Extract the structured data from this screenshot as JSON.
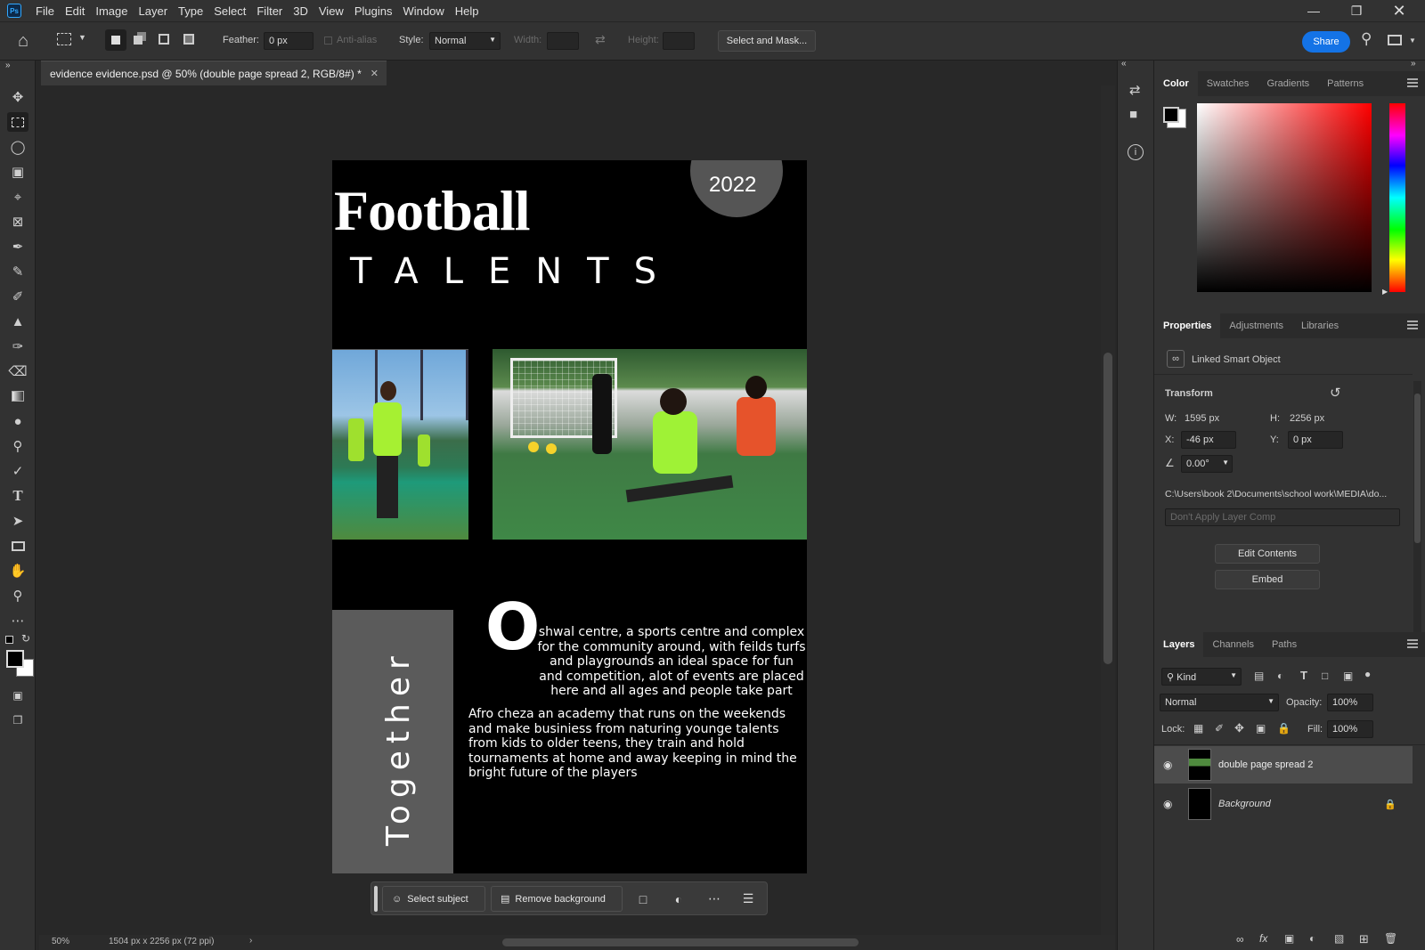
{
  "app": {
    "logo": "Ps",
    "menu": [
      "File",
      "Edit",
      "Image",
      "Layer",
      "Type",
      "Select",
      "Filter",
      "3D",
      "View",
      "Plugins",
      "Window",
      "Help"
    ]
  },
  "options": {
    "feather_label": "Feather:",
    "feather_value": "0 px",
    "antialias_label": "Anti-alias",
    "style_label": "Style:",
    "style_value": "Normal",
    "width_label": "Width:",
    "height_label": "Height:",
    "select_mask": "Select and Mask...",
    "share": "Share"
  },
  "document": {
    "tab_title": "evidence evidence.psd @ 50% (double page spread 2, RGB/8#) *",
    "zoom": "50%",
    "info": "1504 px x 2256 px (72 ppi)"
  },
  "artwork": {
    "year": "2022",
    "title": "Football",
    "subtitle": "TALENTS",
    "vertical": "Together",
    "dropcap": "O",
    "para1": "shwal centre, a sports centre and complex for the community around, with feilds turfs and playgrounds an ideal space for fun and competition, alot of events are placed here and all ages and people take part",
    "para2": "Afro cheza an academy that runs on the weekends and make businiess from naturing younge talents from kids to older teens, they train and hold tournaments at home and away keeping in mind the bright future of the players"
  },
  "color_panel": {
    "tabs": [
      "Color",
      "Swatches",
      "Gradients",
      "Patterns"
    ],
    "hue_color": "#ff0000"
  },
  "properties": {
    "tabs": [
      "Properties",
      "Adjustments",
      "Libraries"
    ],
    "kind": "Linked Smart Object",
    "transform": "Transform",
    "w_label": "W:",
    "w": "1595 px",
    "h_label": "H:",
    "h": "2256 px",
    "x_label": "X:",
    "x": "-46 px",
    "y_label": "Y:",
    "y": "0 px",
    "angle": "0.00°",
    "path": "C:\\Users\\book 2\\Documents\\school work\\MEDIA\\do...",
    "layer_comp": "Don't Apply Layer Comp",
    "edit_contents": "Edit Contents",
    "embed": "Embed"
  },
  "layers_panel": {
    "tabs": [
      "Layers",
      "Channels",
      "Paths"
    ],
    "kind": "Kind",
    "blend": "Normal",
    "opacity_label": "Opacity:",
    "opacity": "100%",
    "lock_label": "Lock:",
    "fill_label": "Fill:",
    "fill": "100%",
    "layers": [
      {
        "name": "double page spread 2"
      },
      {
        "name": "Background"
      }
    ]
  },
  "contextual_bar": {
    "select_subject": "Select subject",
    "remove_background": "Remove background"
  }
}
